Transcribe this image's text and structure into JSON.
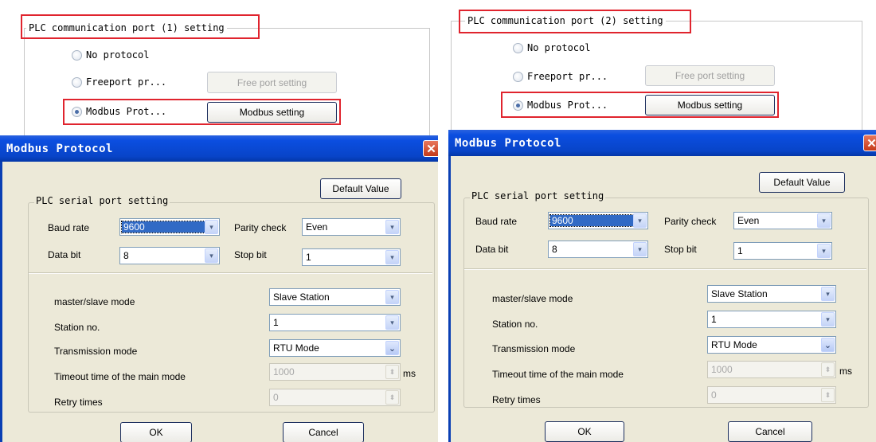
{
  "panels": [
    {
      "port_title": "PLC communication port (1) setting",
      "radios": [
        {
          "label": "No protocol",
          "checked": false
        },
        {
          "label": "Freeport pr...",
          "checked": false
        },
        {
          "label": "Modbus Prot...",
          "checked": true
        }
      ],
      "free_port_button": "Free port setting",
      "modbus_button": "Modbus setting",
      "dialog": {
        "title": "Modbus Protocol",
        "close_glyph": "✕",
        "default_button": "Default Value",
        "serial_group_title": "PLC serial port setting",
        "baud_label": "Baud rate",
        "baud_value": "9600",
        "parity_label": "Parity check",
        "parity_value": "Even",
        "databit_label": "Data bit",
        "databit_value": "8",
        "stopbit_label": "Stop bit",
        "stopbit_value": "1",
        "mode_label": "master/slave mode",
        "mode_value": "Slave Station",
        "station_label": "Station no.",
        "station_value": "1",
        "transmission_label": "Transmission mode",
        "transmission_value": "RTU Mode",
        "timeout_label": "Timeout time of the main mode",
        "timeout_value": "1000",
        "timeout_unit": "ms",
        "retry_label": "Retry times",
        "retry_value": "0",
        "ok_button": "OK",
        "cancel_button": "Cancel"
      }
    },
    {
      "port_title": "PLC communication port (2) setting",
      "radios": [
        {
          "label": "No protocol",
          "checked": false
        },
        {
          "label": "Freeport pr...",
          "checked": false
        },
        {
          "label": "Modbus Prot...",
          "checked": true
        }
      ],
      "free_port_button": "Free port setting",
      "modbus_button": "Modbus setting",
      "dialog": {
        "title": "Modbus Protocol",
        "close_glyph": "✕",
        "default_button": "Default Value",
        "serial_group_title": "PLC serial port setting",
        "baud_label": "Baud rate",
        "baud_value": "9600",
        "parity_label": "Parity check",
        "parity_value": "Even",
        "databit_label": "Data bit",
        "databit_value": "8",
        "stopbit_label": "Stop bit",
        "stopbit_value": "1",
        "mode_label": "master/slave mode",
        "mode_value": "Slave Station",
        "station_label": "Station no.",
        "station_value": "1",
        "transmission_label": "Transmission mode",
        "transmission_value": "RTU Mode",
        "timeout_label": "Timeout time of the main mode",
        "timeout_value": "1000",
        "timeout_unit": "ms",
        "retry_label": "Retry times",
        "retry_value": "0",
        "ok_button": "OK",
        "cancel_button": "Cancel"
      }
    }
  ],
  "icons": {
    "dropdown_arrow": "▾",
    "dropdown_arrow_strong": "⌄",
    "spin_arrows": "⬍"
  },
  "colors": {
    "highlight_red": "#e0242e",
    "titlebar_blue": "#0844c8",
    "dialog_face": "#ece9d8"
  }
}
